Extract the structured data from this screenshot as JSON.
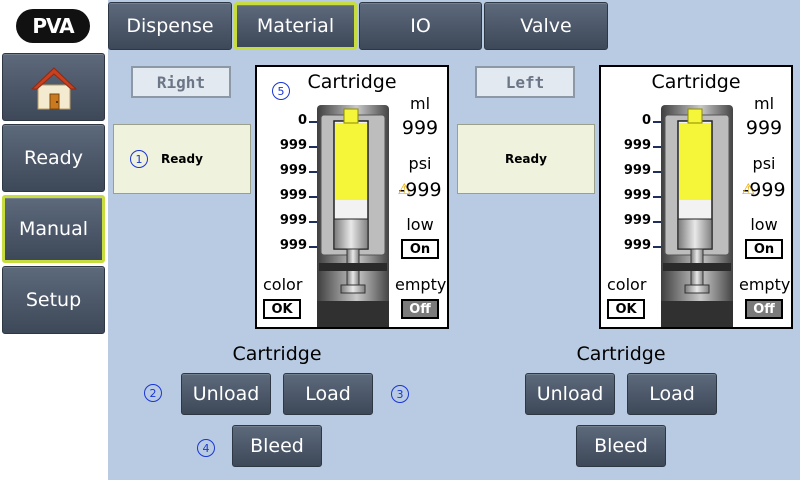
{
  "logo": {
    "text": "PVA"
  },
  "tabs": [
    {
      "label": "Dispense",
      "selected": false
    },
    {
      "label": "Material",
      "selected": true
    },
    {
      "label": "IO",
      "selected": false
    },
    {
      "label": "Valve",
      "selected": false
    }
  ],
  "sidebar": {
    "home_icon": "home-icon",
    "items": [
      {
        "label": "Ready",
        "selected": false
      },
      {
        "label": "Manual",
        "selected": true
      },
      {
        "label": "Setup",
        "selected": false
      }
    ]
  },
  "colors": {
    "accent_selected": "#c6dc3f",
    "background": "#b9cbe2",
    "button": "#4a5566",
    "syringe_material": "#f5f53a",
    "badge": "#1a36d4"
  },
  "right": {
    "side_label": "Right",
    "status": "Ready",
    "cartridge": {
      "title": "Cartridge",
      "scale": [
        "0",
        "999",
        "999",
        "999",
        "999",
        "999"
      ],
      "ml_label": "ml",
      "ml_value": "999",
      "psi_label": "psi",
      "psi_value": "-999",
      "low_label": "low",
      "low_state": "On",
      "empty_label": "empty",
      "empty_state": "Off",
      "color_label": "color",
      "color_state": "OK",
      "fill_level": 0.62
    },
    "section_title": "Cartridge",
    "unload": "Unload",
    "load": "Load",
    "bleed": "Bleed"
  },
  "left": {
    "side_label": "Left",
    "status": "Ready",
    "cartridge": {
      "title": "Cartridge",
      "scale": [
        "0",
        "999",
        "999",
        "999",
        "999",
        "999"
      ],
      "ml_label": "ml",
      "ml_value": "999",
      "psi_label": "psi",
      "psi_value": "-999",
      "low_label": "low",
      "low_state": "On",
      "empty_label": "empty",
      "empty_state": "Off",
      "color_label": "color",
      "color_state": "OK",
      "fill_level": 0.62
    },
    "section_title": "Cartridge",
    "unload": "Unload",
    "load": "Load",
    "bleed": "Bleed"
  },
  "badges": [
    "1",
    "2",
    "3",
    "4",
    "5"
  ]
}
